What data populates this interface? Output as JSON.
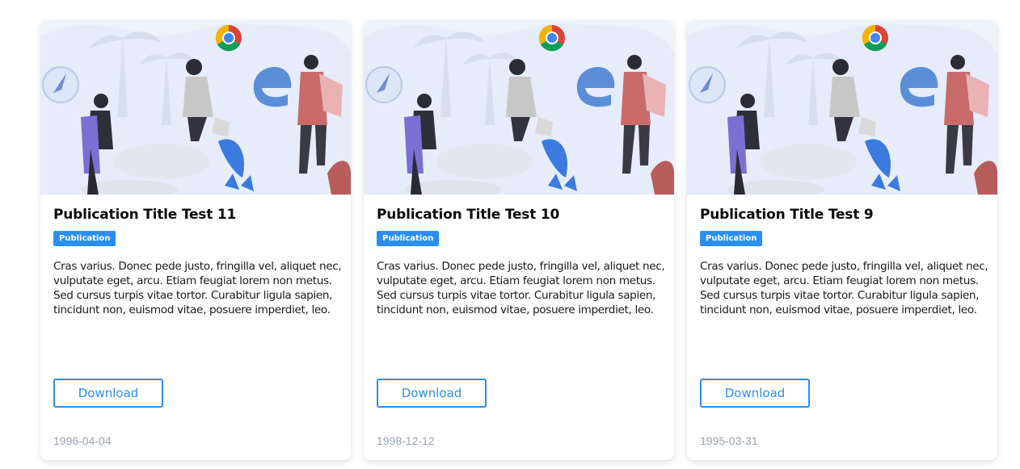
{
  "badge_color": "#2b8ff0",
  "cards": [
    {
      "title": "Publication Title Test 11",
      "badge": "Publication",
      "description": "Cras varius. Donec pede justo, fringilla vel, aliquet nec, vulputate eget, arcu. Etiam feugiat lorem non metus. Sed cursus turpis vitae tortor. Curabitur ligula sapien, tincidunt non, euismod vitae, posuere imperdiet, leo.",
      "button_label": "Download",
      "date": "1996-04-04",
      "image_icons": [
        "chrome-icon",
        "edge-icon",
        "safari-icon"
      ]
    },
    {
      "title": "Publication Title Test 10",
      "badge": "Publication",
      "description": "Cras varius. Donec pede justo, fringilla vel, aliquet nec, vulputate eget, arcu. Etiam feugiat lorem non metus. Sed cursus turpis vitae tortor. Curabitur ligula sapien, tincidunt non, euismod vitae, posuere imperdiet, leo.",
      "button_label": "Download",
      "date": "1998-12-12",
      "image_icons": [
        "chrome-icon",
        "edge-icon",
        "safari-icon"
      ]
    },
    {
      "title": "Publication Title Test 9",
      "badge": "Publication",
      "description": "Cras varius. Donec pede justo, fringilla vel, aliquet nec, vulputate eget, arcu. Etiam feugiat lorem non metus. Sed cursus turpis vitae tortor. Curabitur ligula sapien, tincidunt non, euismod vitae, posuere imperdiet, leo.",
      "button_label": "Download",
      "date": "1995-03-31",
      "image_icons": [
        "chrome-icon",
        "edge-icon",
        "safari-icon"
      ]
    }
  ]
}
